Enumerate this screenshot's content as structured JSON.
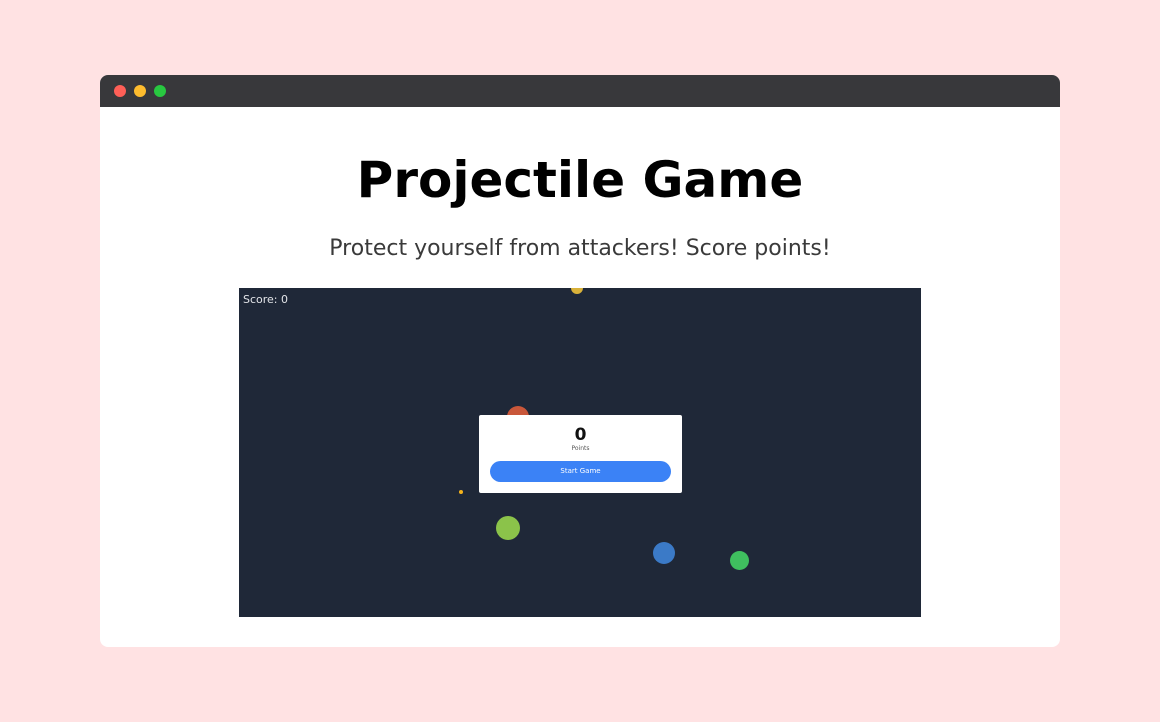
{
  "window": {
    "controls": [
      {
        "name": "close",
        "color": "#ff5f57"
      },
      {
        "name": "minimize",
        "color": "#febc2e"
      },
      {
        "name": "maximize",
        "color": "#28c840"
      }
    ]
  },
  "page": {
    "title": "Projectile Game",
    "subtitle": "Protect yourself from attackers! Score points!"
  },
  "game": {
    "score_text": "Score: 0",
    "background_color": "#1f2838",
    "modal": {
      "points_value": "0",
      "points_label": "Points",
      "start_button_label": "Start Game"
    },
    "enemies": [
      {
        "name": "enemy-yellow-top",
        "color": "#d9b23a"
      },
      {
        "name": "enemy-orange",
        "color": "#c9573a"
      },
      {
        "name": "enemy-lime",
        "color": "#8bc34a"
      },
      {
        "name": "enemy-blue",
        "color": "#3b7ac7"
      },
      {
        "name": "enemy-green",
        "color": "#3fbf5f"
      }
    ],
    "projectile": {
      "color": "#f5b31b"
    }
  }
}
